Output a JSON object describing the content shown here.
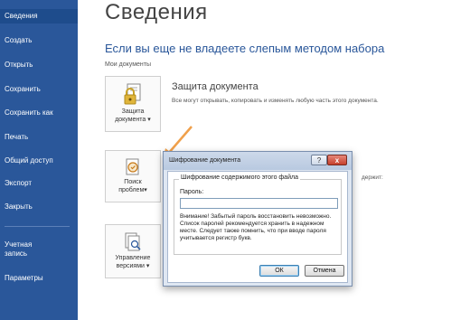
{
  "sidebar": {
    "items": [
      {
        "label": "Сведения",
        "active": true
      },
      {
        "label": "Создать"
      },
      {
        "label": "Открыть"
      },
      {
        "label": "Сохранить"
      },
      {
        "label": "Сохранить как"
      },
      {
        "label": "Печать"
      },
      {
        "label": "Общий доступ"
      },
      {
        "label": "Экспорт"
      },
      {
        "label": "Закрыть"
      },
      {
        "label": "Учетная запись"
      },
      {
        "label": "Параметры"
      }
    ]
  },
  "main": {
    "title": "Сведения",
    "subtitle": "Если вы еще не владеете слепым методом набора",
    "location": "Мои документы",
    "protect": {
      "tile_label_1": "Защита",
      "tile_label_2": "документа",
      "heading": "Защита документа",
      "description": "Все могут открывать, копировать и изменять любую часть этого документа."
    },
    "check": {
      "tile_label_1": "Поиск",
      "tile_label_2": "проблем",
      "side_text": "держит:"
    },
    "versions": {
      "tile_label_1": "Управление",
      "tile_label_2": "версиями"
    }
  },
  "dialog": {
    "title": "Шифрование документа",
    "help_glyph": "?",
    "close_glyph": "x",
    "group_title": "Шифрование содержимого этого файла",
    "password_label": "Пароль:",
    "password_value": "",
    "warning": "Внимание! Забытый пароль восстановить невозможно. Список паролей рекомендуется хранить в надежном месте. Следует также помнить, что при вводе пароля учитывается регистр букв.",
    "ok_label": "ОК",
    "cancel_label": "Отмена"
  },
  "colors": {
    "sidebar_bg": "#2a579a",
    "accent": "#2a579a",
    "arrow": "#f0a04b"
  },
  "icons": [
    "lock-document-icon",
    "inspect-document-icon",
    "versions-icon",
    "dropdown-arrow-icon"
  ]
}
